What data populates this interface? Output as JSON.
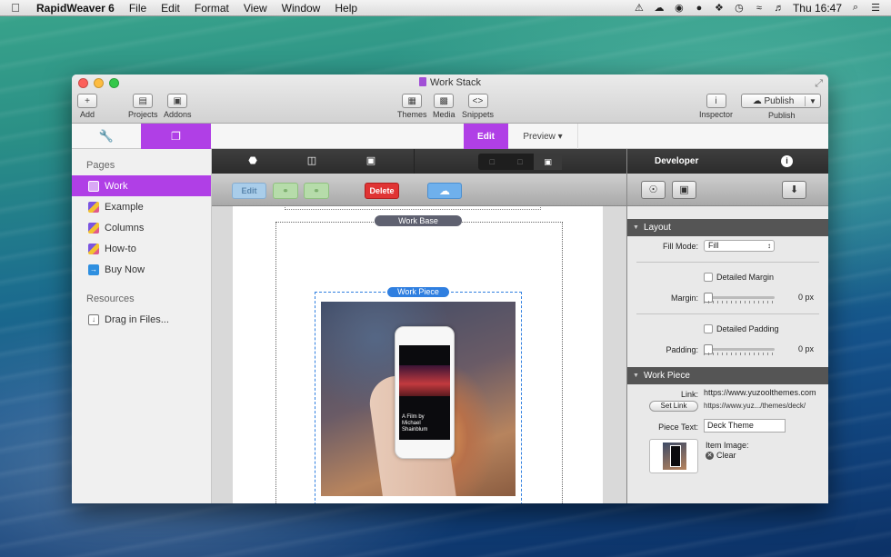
{
  "menubar": {
    "apple": "",
    "app_name": "RapidWeaver 6",
    "menus": [
      "File",
      "Edit",
      "Format",
      "View",
      "Window",
      "Help"
    ],
    "status_icons": [
      "bell-icon",
      "cloud-icon",
      "camera-icon",
      "lock-icon",
      "dropbox-icon",
      "time-machine-icon",
      "wifi-icon",
      "volume-icon"
    ],
    "clock": "Thu 16:47",
    "search_glyph": "⌕",
    "list_glyph": "☰"
  },
  "window": {
    "title": "Work Stack",
    "toolbar": {
      "add": "Add",
      "projects": "Projects",
      "addons": "Addons",
      "themes": "Themes",
      "media": "Media",
      "snippets": "Snippets",
      "inspector": "Inspector",
      "publish": "Publish",
      "publish_caption": "Publish"
    },
    "tabs": {
      "edit": "Edit",
      "preview": "Preview ▾"
    }
  },
  "sidebar": {
    "pages_header": "Pages",
    "pages": [
      {
        "label": "Work",
        "active": true
      },
      {
        "label": "Example"
      },
      {
        "label": "Columns"
      },
      {
        "label": "How-to"
      },
      {
        "label": "Buy Now"
      }
    ],
    "resources_header": "Resources",
    "drag_in": "Drag in Files..."
  },
  "editor": {
    "buttons": {
      "edit": "Edit",
      "link": "⚭",
      "unlink": "⚭",
      "delete": "Delete",
      "cloud": "☁"
    },
    "work_base_label": "Work Base",
    "work_piece_label": "Work Piece",
    "film_text": [
      "A Film by",
      "Michael",
      "Shainblum"
    ]
  },
  "inspector": {
    "title": "Developer",
    "info": "i",
    "layout": {
      "header": "Layout",
      "fill_mode_label": "Fill Mode:",
      "fill_mode_value": "Fill",
      "detailed_margin": "Detailed Margin",
      "margin_label": "Margin:",
      "margin_value": "0 px",
      "detailed_padding": "Detailed Padding",
      "padding_label": "Padding:",
      "padding_value": "0 px"
    },
    "work_piece": {
      "header": "Work Piece",
      "link_label": "Link:",
      "link_url": "https://www.yuzoolthemes.com",
      "set_link": "Set Link",
      "link_short": "https://www.yuz.../themes/deck/",
      "piece_text_label": "Piece Text:",
      "piece_text_value": "Deck Theme",
      "item_image_label": "Item Image:",
      "clear": "Clear"
    }
  }
}
